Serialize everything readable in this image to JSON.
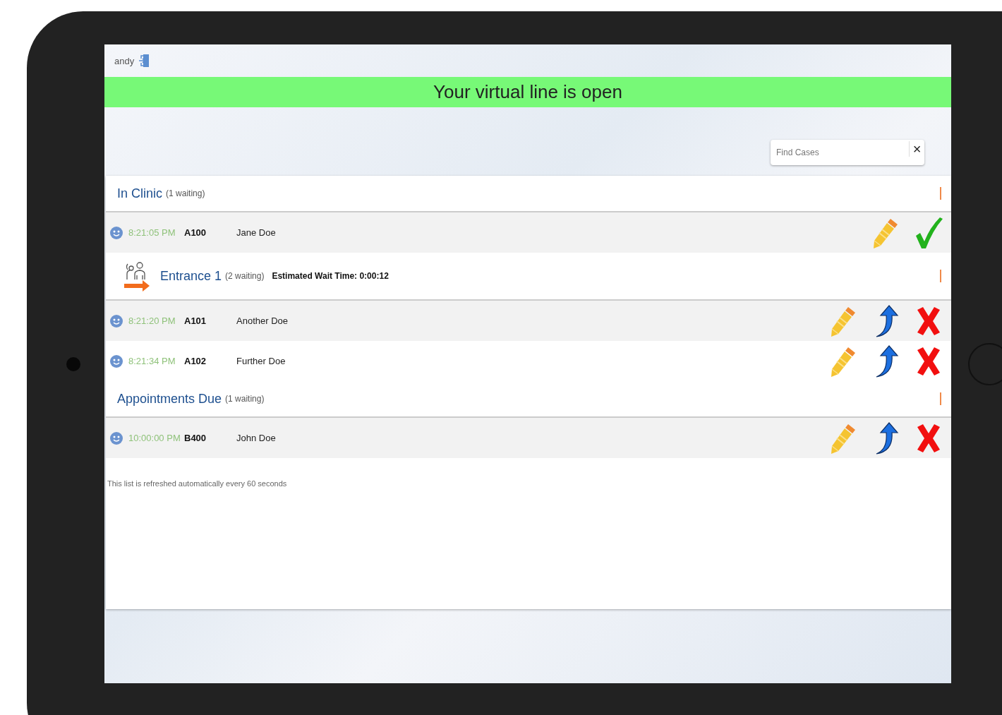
{
  "user": {
    "name": "andy"
  },
  "banner": {
    "text": "Your virtual line is open"
  },
  "search": {
    "placeholder": "Find Cases",
    "clear": "×"
  },
  "sections": [
    {
      "kind": "clinic",
      "title": "In Clinic",
      "count": "(1 waiting)",
      "rows": [
        {
          "time": "8:21:05 PM",
          "code": "A100",
          "name": "Jane Doe",
          "actions": [
            {
              "kind": "edit"
            },
            {
              "kind": "complete"
            }
          ]
        }
      ]
    },
    {
      "kind": "entrance",
      "title": "Entrance 1",
      "count": "(2 waiting)",
      "wait_time": "Estimated Wait Time: 0:00:12",
      "rows": [
        {
          "time": "8:21:20 PM",
          "code": "A101",
          "name": "Another Doe",
          "actions": [
            {
              "kind": "edit"
            },
            {
              "kind": "move"
            },
            {
              "kind": "remove"
            }
          ]
        },
        {
          "time": "8:21:34 PM",
          "code": "A102",
          "name": "Further Doe",
          "actions": [
            {
              "kind": "edit"
            },
            {
              "kind": "move"
            },
            {
              "kind": "remove"
            }
          ]
        }
      ]
    },
    {
      "kind": "appointments",
      "title": "Appointments Due",
      "count": "(1 waiting)",
      "rows": [
        {
          "time": "10:00:00 PM",
          "code": "B400",
          "name": "John Doe",
          "actions": [
            {
              "kind": "edit"
            },
            {
              "kind": "move"
            },
            {
              "kind": "remove"
            }
          ]
        }
      ]
    }
  ],
  "footer_note": "This list is refreshed automatically every 60 seconds"
}
